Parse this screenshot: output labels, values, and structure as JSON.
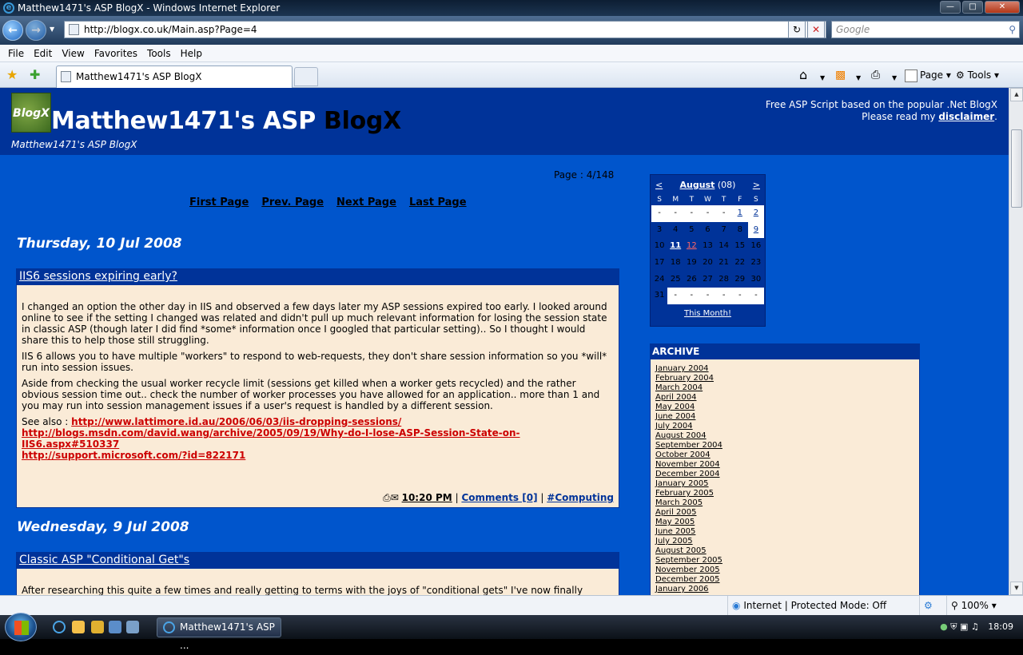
{
  "window": {
    "title": "Matthew1471's ASP BlogX - Windows Internet Explorer"
  },
  "browser": {
    "address": "http://blogx.co.uk/Main.asp?Page=4",
    "search_placeholder": "Google",
    "menu": [
      "File",
      "Edit",
      "View",
      "Favorites",
      "Tools",
      "Help"
    ],
    "tab_title": "Matthew1471's ASP BlogX",
    "cmd_page": "Page",
    "cmd_tools": "Tools",
    "status_zone": "Internet | Protected Mode: Off",
    "zoom": "100%"
  },
  "site": {
    "logo_text": "BlogX",
    "title_main": "Matthew1471's ASP ",
    "title_accent": "BlogX",
    "tagline": "Matthew1471's ASP BlogX",
    "header_line1": "Free ASP Script based on the popular .Net BlogX",
    "header_line2_prefix": "Please read my ",
    "header_disclaimer": "disclaimer",
    "header_line2_suffix": "."
  },
  "paging": {
    "indicator": "Page : 4/148",
    "first": "First Page",
    "prev": "Prev. Page",
    "next": "Next Page",
    "last": "Last Page"
  },
  "posts": [
    {
      "date": "Thursday, 10 Jul 2008",
      "title": "IIS6 sessions expiring early?",
      "p1": "I changed an option the other day in IIS and observed a few days later my ASP sessions expired too early. I looked around online to see if the setting I changed was related and didn't pull up much relevant information for losing the session state in classic ASP (though later I did find *some* information once I googled that particular setting).. So I thought I would share this to help those still struggling.",
      "p2": "IIS 6 allows you to have multiple \"workers\" to respond to web-requests, they don't share session information so you *will* run into session issues.",
      "p3": "Aside from checking the usual worker recycle limit (sessions get killed when a worker gets recycled) and the rather obvious session time out.. check the number of worker processes you have allowed for an application.. more than 1 and you may run into session management issues if a user's request is handled by a different session.",
      "see_also": "See also : ",
      "link1": "http://www.lattimore.id.au/2006/06/03/iis-dropping-sessions/",
      "link2": "http://blogs.msdn.com/david.wang/archive/2005/09/19/Why-do-I-lose-ASP-Session-State-on-IIS6.aspx#510337",
      "link3": "http://support.microsoft.com/?id=822171",
      "time": "10:20 PM",
      "comments": "Comments [0]",
      "category": "#Computing",
      "sep": "|"
    },
    {
      "date": "Wednesday, 9 Jul 2008",
      "title": "Classic ASP \"Conditional Get\"s",
      "p1": "After researching this quite a few times and really getting to terms with the joys of \"conditional gets\" I've now finally"
    }
  ],
  "calendar": {
    "prev": "<",
    "next": ">",
    "month": "August",
    "year_suffix": " (08)",
    "dow": [
      "S",
      "M",
      "T",
      "W",
      "T",
      "F",
      "S"
    ],
    "this_month": "This Month!",
    "cells": [
      {
        "t": "-",
        "k": "blank"
      },
      {
        "t": "-",
        "k": "blank"
      },
      {
        "t": "-",
        "k": "blank"
      },
      {
        "t": "-",
        "k": "blank"
      },
      {
        "t": "-",
        "k": "blank"
      },
      {
        "t": "1",
        "k": "wlk"
      },
      {
        "t": "2",
        "k": "wlk"
      },
      {
        "t": "3",
        "k": ""
      },
      {
        "t": "4",
        "k": ""
      },
      {
        "t": "5",
        "k": ""
      },
      {
        "t": "6",
        "k": ""
      },
      {
        "t": "7",
        "k": ""
      },
      {
        "t": "8",
        "k": ""
      },
      {
        "t": "9",
        "k": "wlk"
      },
      {
        "t": "10",
        "k": ""
      },
      {
        "t": "11",
        "k": "lk"
      },
      {
        "t": "12",
        "k": "today"
      },
      {
        "t": "13",
        "k": ""
      },
      {
        "t": "14",
        "k": ""
      },
      {
        "t": "15",
        "k": ""
      },
      {
        "t": "16",
        "k": ""
      },
      {
        "t": "17",
        "k": ""
      },
      {
        "t": "18",
        "k": ""
      },
      {
        "t": "19",
        "k": ""
      },
      {
        "t": "20",
        "k": ""
      },
      {
        "t": "21",
        "k": ""
      },
      {
        "t": "22",
        "k": ""
      },
      {
        "t": "23",
        "k": ""
      },
      {
        "t": "24",
        "k": ""
      },
      {
        "t": "25",
        "k": ""
      },
      {
        "t": "26",
        "k": ""
      },
      {
        "t": "27",
        "k": ""
      },
      {
        "t": "28",
        "k": ""
      },
      {
        "t": "29",
        "k": ""
      },
      {
        "t": "30",
        "k": ""
      },
      {
        "t": "31",
        "k": ""
      },
      {
        "t": "-",
        "k": "blank"
      },
      {
        "t": "-",
        "k": "blank"
      },
      {
        "t": "-",
        "k": "blank"
      },
      {
        "t": "-",
        "k": "blank"
      },
      {
        "t": "-",
        "k": "blank"
      },
      {
        "t": "-",
        "k": "blank"
      }
    ]
  },
  "archive": {
    "heading": "ARCHIVE",
    "items": [
      "January 2004",
      "February 2004",
      "March 2004",
      "April 2004",
      "May 2004",
      "June 2004",
      "July 2004",
      "August 2004",
      "September 2004",
      "October 2004",
      "November 2004",
      "December 2004",
      "January 2005",
      "February 2005",
      "March 2005",
      "April 2005",
      "May 2005",
      "June 2005",
      "July 2005",
      "August 2005",
      "September 2005",
      "November 2005",
      "December 2005",
      "January 2006"
    ]
  },
  "taskbar": {
    "item": "Matthew1471's ASP ...",
    "clock": "18:09"
  },
  "colors": {
    "page_bg": "#0055cc",
    "header_bg": "#003399",
    "post_bg": "#faebd7",
    "link_red": "#cc0000"
  }
}
